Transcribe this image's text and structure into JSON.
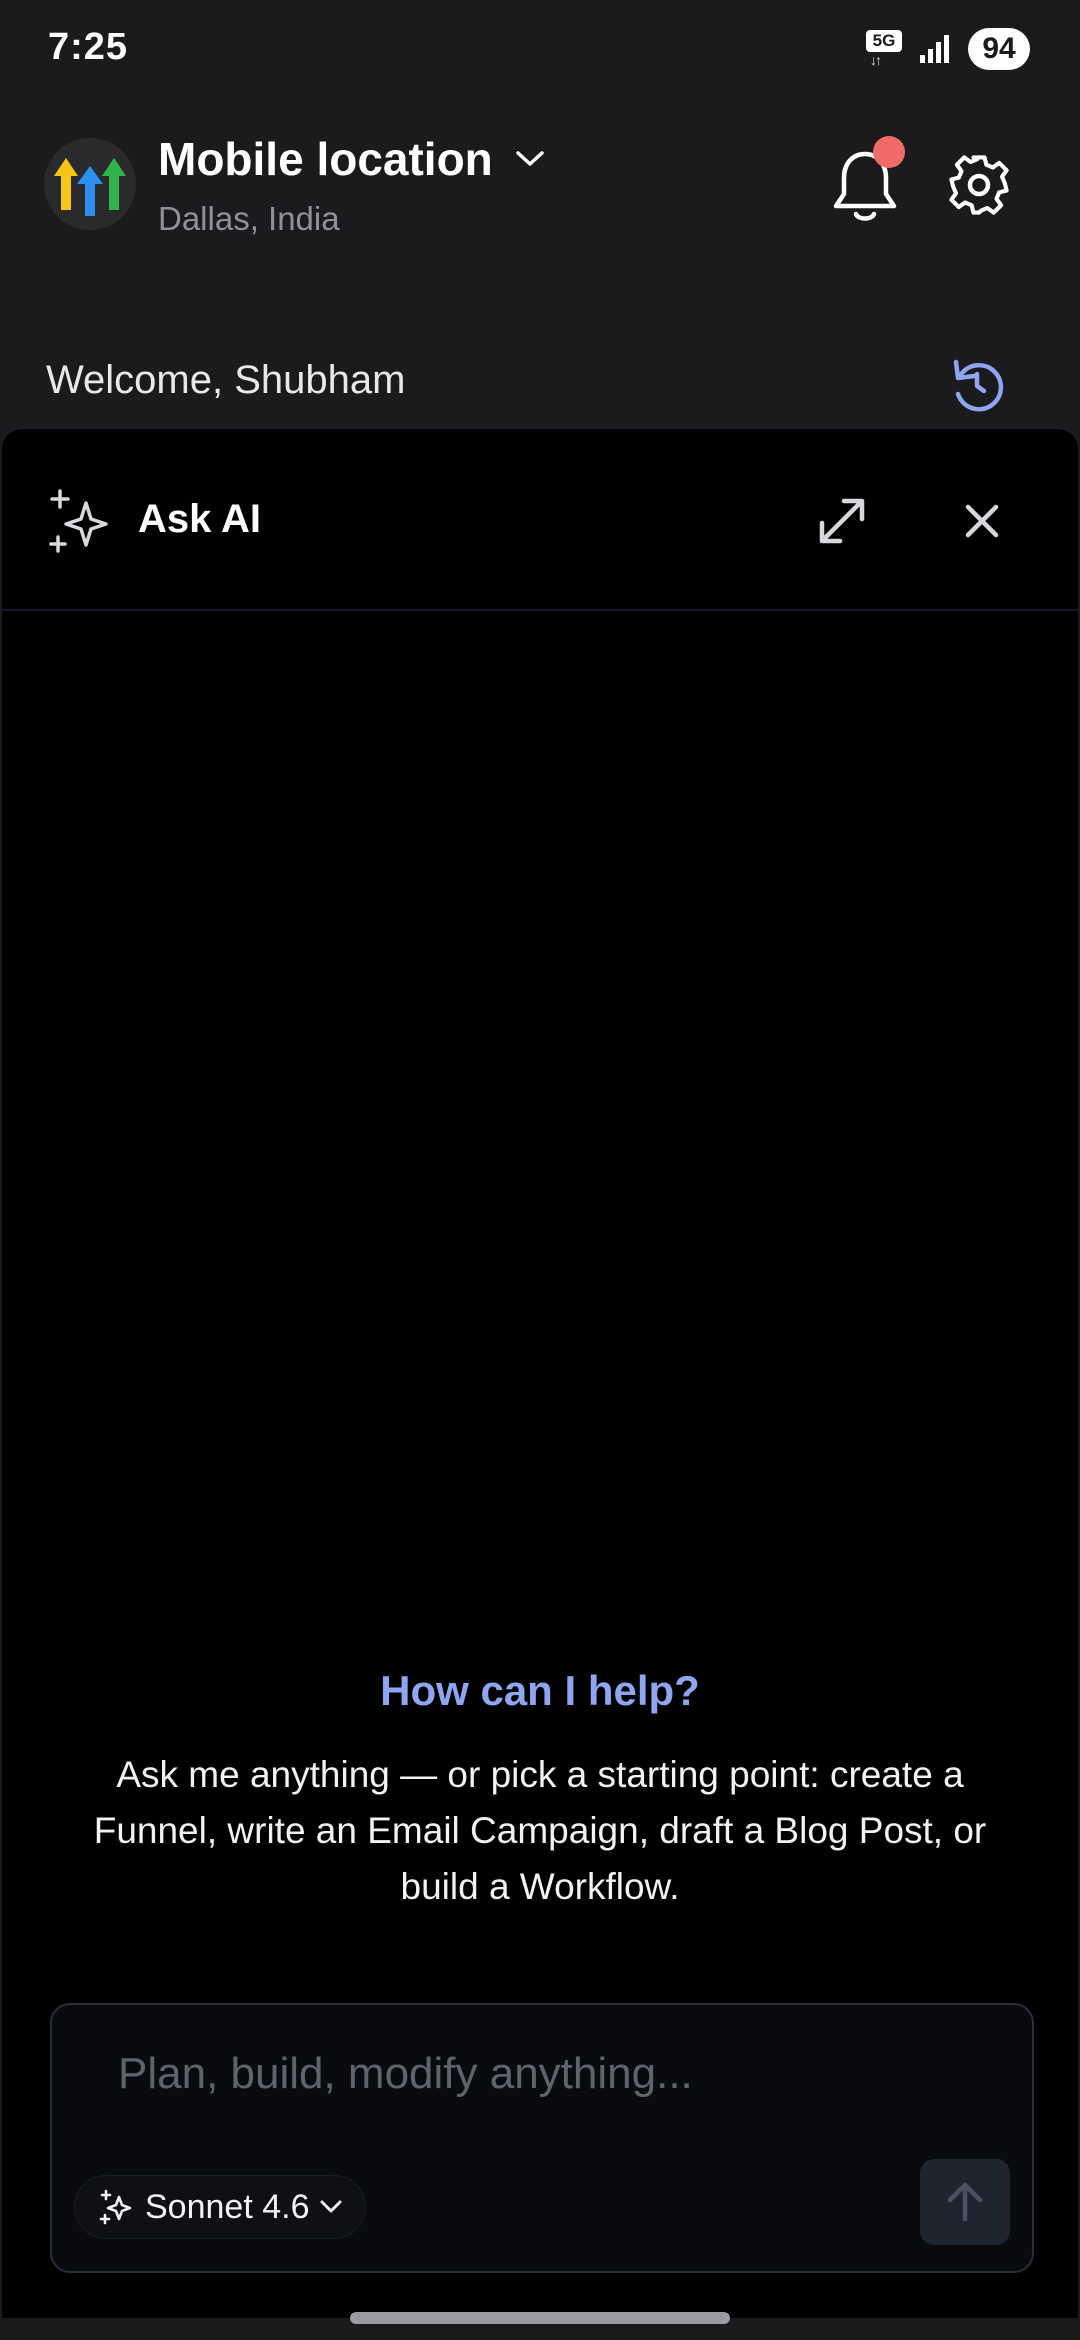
{
  "status_bar": {
    "time": "7:25",
    "network": "5G",
    "battery": "94"
  },
  "header": {
    "location_title": "Mobile location",
    "location_subtitle": "Dallas, India",
    "notification_dot_color": "#f06a6a"
  },
  "welcome": {
    "text": "Welcome, Shubham"
  },
  "ask_ai": {
    "title": "Ask AI",
    "help_title": "How can I help?",
    "help_body": "Ask me anything — or pick a starting point: create a Funnel, write an Email Campaign, draft a Blog Post, or build a Workflow.",
    "input_placeholder": "Plan, build, modify anything...",
    "model_label": "Sonnet 4.6"
  },
  "colors": {
    "accent": "#8ea6f2",
    "background": "#1b1b1d",
    "panel": "#000000"
  },
  "icons": [
    "logo",
    "chevron-down-icon",
    "bell-icon",
    "gear-icon",
    "refresh-icon",
    "sparkle-icon",
    "expand-icon",
    "close-icon",
    "arrow-up-icon"
  ]
}
